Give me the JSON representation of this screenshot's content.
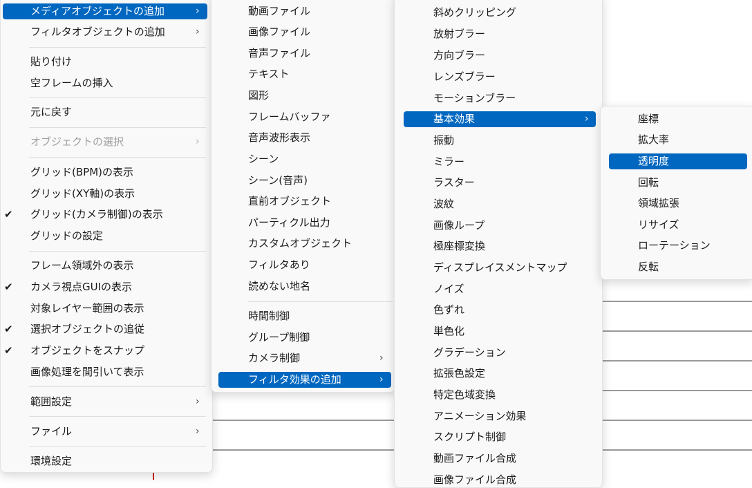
{
  "colors": {
    "highlight": "#0067c0",
    "menu_bg": "#f9f9f9",
    "separator": "#dedede",
    "disabled": "#a0a0a0"
  },
  "main_menu": {
    "add_media_object": "メディアオブジェクトの追加",
    "add_filter_object": "フィルタオブジェクトの追加",
    "paste": "貼り付け",
    "insert_empty_frame": "空フレームの挿入",
    "undo": "元に戻す",
    "select_object": "オブジェクトの選択",
    "show_grid_bpm": "グリッド(BPM)の表示",
    "show_grid_xy": "グリッド(XY軸)の表示",
    "show_grid_camera": "グリッド(カメラ制御)の表示",
    "grid_settings": "グリッドの設定",
    "show_outside_frame": "フレーム領域外の表示",
    "show_camera_gui": "カメラ視点GUIの表示",
    "show_target_layer_range": "対象レイヤー範囲の表示",
    "follow_selected_object": "選択オブジェクトの追従",
    "snap_object": "オブジェクトをスナップ",
    "thin_image_processing": "画像処理を間引いて表示",
    "range_settings": "範囲設定",
    "file": "ファイル",
    "environment_settings": "環境設定"
  },
  "media_menu": {
    "video_file": "動画ファイル",
    "image_file": "画像ファイル",
    "audio_file": "音声ファイル",
    "text": "テキスト",
    "shape": "図形",
    "frame_buffer": "フレームバッファ",
    "audio_waveform": "音声波形表示",
    "scene": "シーン",
    "scene_audio": "シーン(音声)",
    "previous_object": "直前オブジェクト",
    "particle_output": "パーティクル出力",
    "custom_object": "カスタムオブジェクト",
    "with_filter": "フィルタあり",
    "unreadable_place": "読めない地名",
    "time_control": "時間制御",
    "group_control": "グループ制御",
    "camera_control": "カメラ制御",
    "add_filter_effect": "フィルタ効果の追加"
  },
  "filter_menu": {
    "diagonal_clipping": "斜めクリッピング",
    "radial_blur": "放射ブラー",
    "directional_blur": "方向ブラー",
    "lens_blur": "レンズブラー",
    "motion_blur": "モーションブラー",
    "basic_effects": "基本効果",
    "vibration": "振動",
    "mirror": "ミラー",
    "raster": "ラスター",
    "ripple": "波紋",
    "image_loop": "画像ループ",
    "polar_transform": "極座標変換",
    "displacement_map": "ディスプレイスメントマップ",
    "noise": "ノイズ",
    "color_shift": "色ずれ",
    "monochrome": "単色化",
    "gradation": "グラデーション",
    "extended_color": "拡張色設定",
    "specific_color_conversion": "特定色域変換",
    "animation_effect": "アニメーション効果",
    "script_control": "スクリプト制御",
    "video_composite": "動画ファイル合成",
    "image_composite": "画像ファイル合成"
  },
  "basic_menu": {
    "coordinates": "座標",
    "zoom_ratio": "拡大率",
    "transparency": "透明度",
    "rotation": "回転",
    "area_expand": "領域拡張",
    "resize": "リサイズ",
    "rotation_90": "ローテーション",
    "flip": "反転"
  },
  "icons": {
    "submenu": "chevron-right-icon",
    "checked": "checkmark-icon"
  },
  "glyphs": {
    "chevron": "›",
    "check": "✔"
  }
}
